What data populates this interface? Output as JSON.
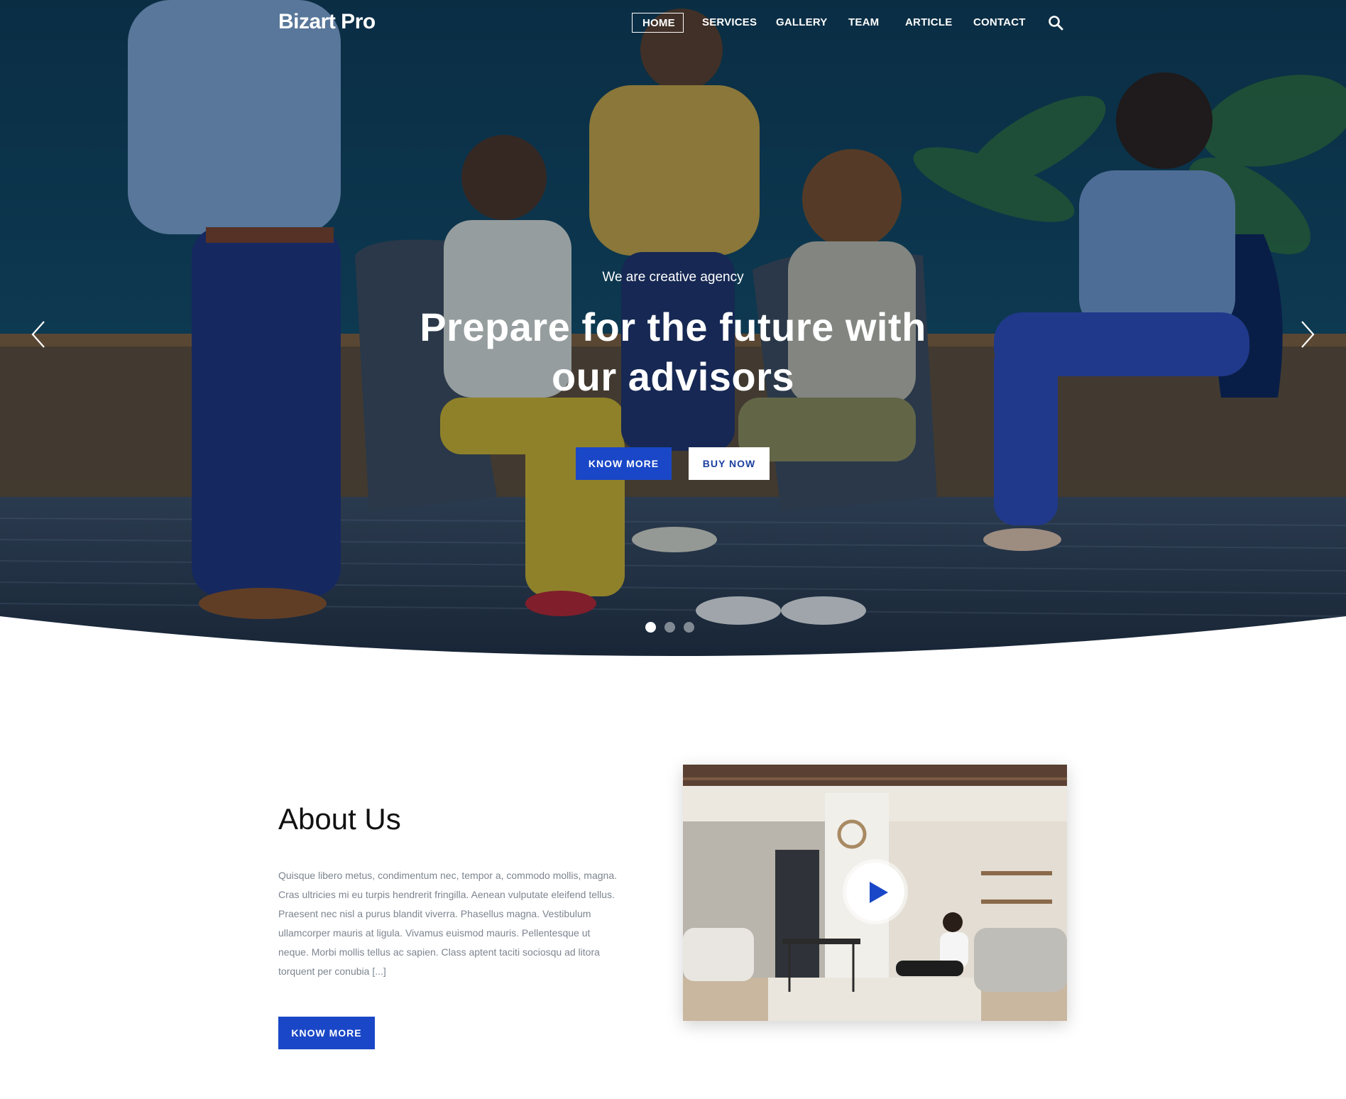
{
  "header": {
    "logo": "Bizart Pro",
    "nav": [
      "HOME",
      "SERVICES",
      "GALLERY",
      "TEAM",
      "ARTICLE",
      "CONTACT"
    ],
    "active_item": "HOME",
    "search_icon": "search-icon"
  },
  "hero": {
    "subtitle": "We are creative agency",
    "title": "Prepare for the future with our advisors",
    "primary_button": "KNOW MORE",
    "secondary_button": "BUY NOW",
    "prev_icon": "chevron-left-icon",
    "next_icon": "chevron-right-icon",
    "slides_total": 3,
    "active_slide": 1
  },
  "about": {
    "title": "About Us",
    "text": "Quisque libero metus, condimentum nec, tempor a, commodo mollis, magna. Cras ultricies mi eu turpis hendrerit fringilla. Aenean vulputate eleifend tellus. Praesent nec nisl a purus blandit viverra. Phasellus magna. Vestibulum ullamcorper mauris at ligula. Vivamus euismod mauris. Pellentesque ut neque. Morbi mollis tellus ac sapien. Class aptent taciti sociosqu ad litora torquent per conubia [...]",
    "button": "KNOW MORE",
    "play_icon": "play-icon"
  },
  "colors": {
    "accent": "#1a47c7",
    "hero_overlay": "#0e3a5a",
    "body_text": "#7d8590"
  }
}
